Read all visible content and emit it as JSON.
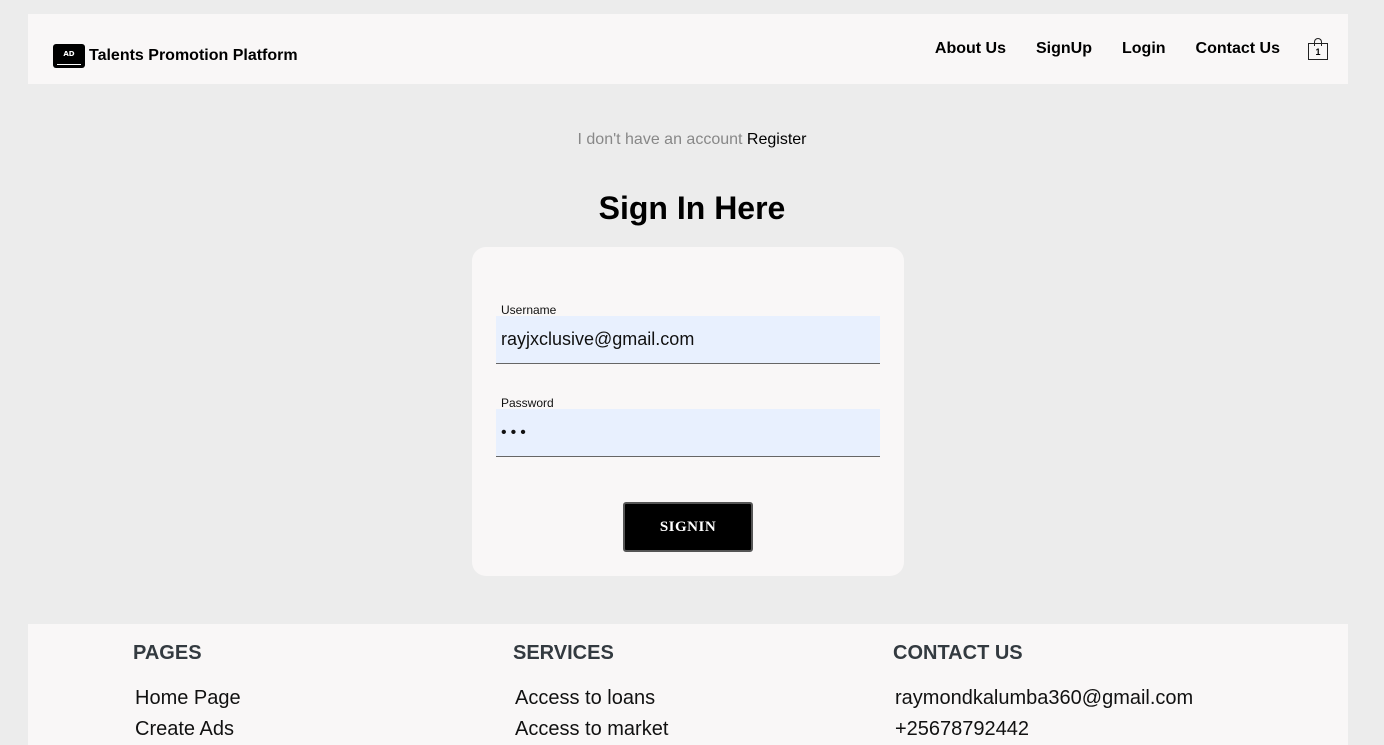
{
  "header": {
    "logo_text": "AD",
    "brand": "Talents Promotion Platform",
    "nav": [
      "About Us",
      "SignUp",
      "Login",
      "Contact Us"
    ],
    "cart_count": "1",
    "cart_icon": "shopping-bag-icon"
  },
  "account": {
    "prompt": "I don't have an account",
    "register_link": "Register"
  },
  "signin": {
    "title": "Sign In Here",
    "username_label": "Username",
    "username_value": "rayjxclusive@gmail.com",
    "password_label": "Password",
    "password_value": "•••",
    "button": "SIGNIN"
  },
  "footer": {
    "pages": {
      "title": "PAGES",
      "items": [
        "Home Page",
        "Create Ads"
      ]
    },
    "services": {
      "title": "SERVICES",
      "items": [
        "Access to loans",
        "Access to market"
      ]
    },
    "contact": {
      "title": "CONTACT US",
      "items": [
        "raymondkalumba360@gmail.com",
        "+25678792442"
      ]
    }
  },
  "colors": {
    "page_bg": "#ececec",
    "panel_bg": "#f9f7f7",
    "input_bg": "#e8f0fe",
    "button_bg": "#000000"
  }
}
